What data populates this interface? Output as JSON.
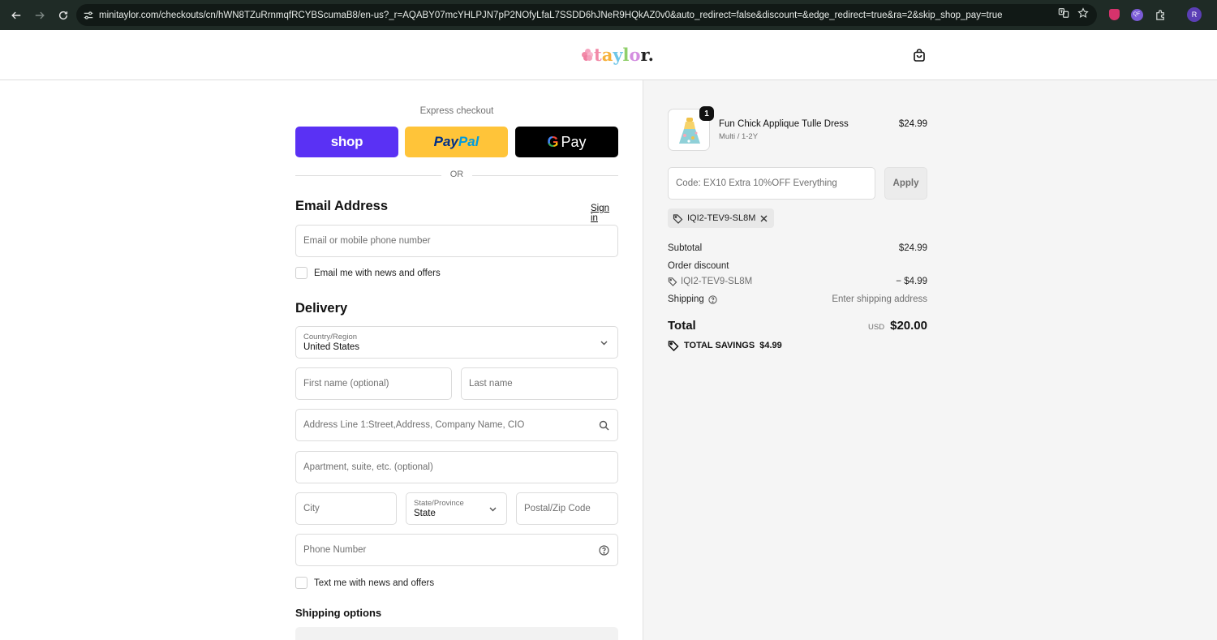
{
  "browser": {
    "url": "minitaylor.com/checkouts/cn/hWN8TZuRrnmqfRCYBScumaB8/en-us?_r=AQABY07mcYHLPJN7pP2NOfyLfaL7SSDD6hJNeR9HQkAZ0v0&auto_redirect=false&discount=&edge_redirect=true&ra=2&skip_shop_pay=true",
    "profile_initial": "R",
    "ext_label": "QF"
  },
  "header": {
    "logo_letters": [
      "t",
      "a",
      "y",
      "l",
      "o",
      "r."
    ]
  },
  "express": {
    "title": "Express checkout",
    "shop_label": "shop",
    "paypal_part1": "Pay",
    "paypal_part2": "Pal",
    "gpay_g": "G",
    "gpay_label": "Pay",
    "or_label": "OR"
  },
  "contact": {
    "title": "Email Address",
    "sign_in": "Sign in",
    "email_placeholder": "Email or mobile phone number",
    "news_label": "Email me with news and offers"
  },
  "delivery": {
    "title": "Delivery",
    "country_label": "Country/Region",
    "country_value": "United States",
    "first_name": "First name (optional)",
    "last_name": "Last name",
    "address": "Address Line 1:Street,Address, Company Name, CIO",
    "apartment": "Apartment, suite, etc. (optional)",
    "city": "City",
    "state_label": "State/Province",
    "state_value": "State",
    "zip": "Postal/Zip Code",
    "phone": "Phone Number",
    "text_label": "Text me with news and offers"
  },
  "shipping_options": {
    "title": "Shipping options"
  },
  "summary": {
    "item": {
      "quantity": "1",
      "name": "Fun Chick Applique Tulle Dress",
      "variant": "Multi / 1-2Y",
      "price": "$24.99"
    },
    "discount_placeholder": "Code: EX10 Extra 10%OFF Everything",
    "apply_label": "Apply",
    "applied_code": "IQI2-TEV9-SL8M",
    "subtotal_label": "Subtotal",
    "subtotal_value": "$24.99",
    "order_discount_label": "Order discount",
    "discount_code": "IQI2-TEV9-SL8M",
    "discount_value": "− $4.99",
    "shipping_label": "Shipping",
    "shipping_value": "Enter shipping address",
    "total_label": "Total",
    "currency": "USD",
    "total_value": "$20.00",
    "savings_label": "TOTAL SAVINGS",
    "savings_value": "$4.99"
  }
}
